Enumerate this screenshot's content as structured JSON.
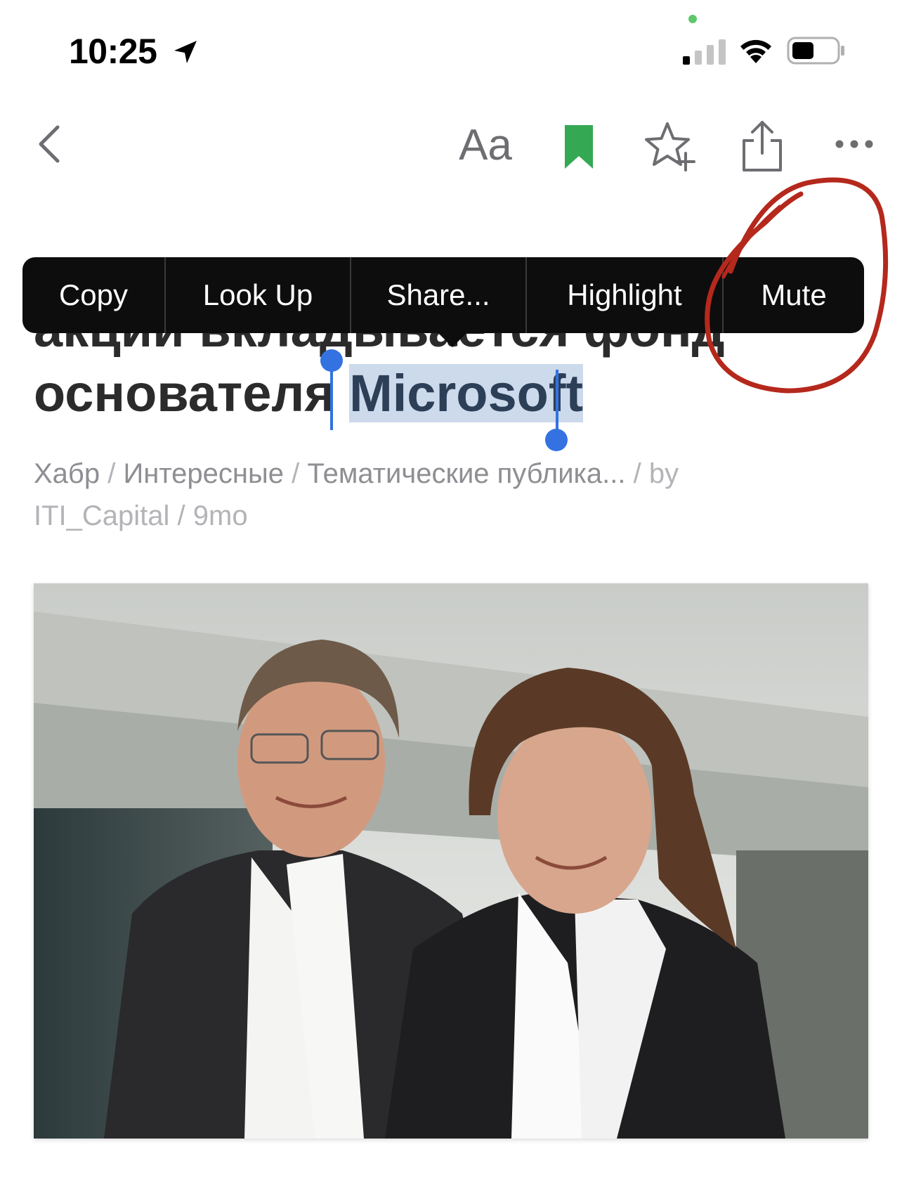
{
  "status_bar": {
    "time": "10:25",
    "icons": [
      "location-arrow-icon",
      "cellular-signal-icon",
      "wifi-icon",
      "battery-icon"
    ]
  },
  "toolbar": {
    "font_settings_label": "Aa",
    "icons": [
      "chevron-left-icon",
      "bookmark-icon",
      "star-plus-icon",
      "share-icon",
      "more-icon"
    ],
    "bookmark_color": "#34a853"
  },
  "article": {
    "title_line_2": "акции вкладывается фонд",
    "title_line_3_prefix": "основателя ",
    "selected_text": "Microsoft",
    "source": "Хабр",
    "categories_1": "Интересные",
    "categories_2": "Тематические публика...",
    "by_label": "by",
    "author": "ITI_Capital",
    "age": "9mo"
  },
  "edit_menu": {
    "items": [
      "Copy",
      "Look Up",
      "Share...",
      "Highlight",
      "Mute"
    ]
  },
  "colors": {
    "selection_bg": "#ccdaec",
    "selection_handle": "#3372e0",
    "menu_bg": "#0d0d0d",
    "annotation": "#b5281c"
  }
}
